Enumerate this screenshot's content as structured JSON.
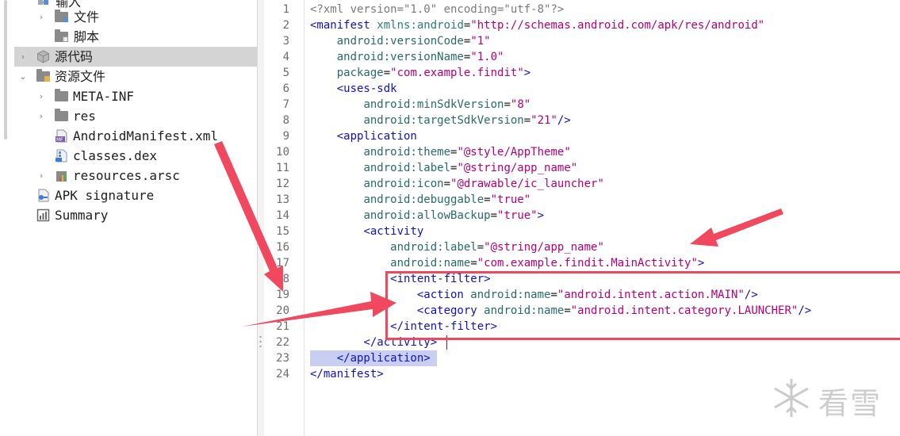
{
  "tree": {
    "items": [
      {
        "label": "输入",
        "chevron": "▸",
        "icon": "package-icon"
      },
      {
        "label": "文件",
        "chevron": "›",
        "icon": "folder-icon"
      },
      {
        "label": "脚本",
        "chevron": "",
        "icon": "folder-icon"
      },
      {
        "label": "源代码",
        "chevron": "›",
        "icon": "package-icon"
      },
      {
        "label": "资源文件",
        "chevron": "⌄",
        "icon": "folder-icon"
      },
      {
        "label": "META-INF",
        "chevron": "›",
        "icon": "folder-icon"
      },
      {
        "label": "res",
        "chevron": "›",
        "icon": "folder-icon"
      },
      {
        "label": "AndroidManifest.xml",
        "chevron": "",
        "icon": "manifest-file-icon"
      },
      {
        "label": "classes.dex",
        "chevron": "",
        "icon": "dex-file-icon"
      },
      {
        "label": "resources.arsc",
        "chevron": "›",
        "icon": "arsc-file-icon"
      },
      {
        "label": "APK signature",
        "chevron": "",
        "icon": "signature-icon"
      },
      {
        "label": "Summary",
        "chevron": "",
        "icon": "summary-icon"
      }
    ],
    "selected_index": 3
  },
  "editor": {
    "line_numbers": [
      "1",
      "2",
      "3",
      "4",
      "5",
      "6",
      "7",
      "8",
      "9",
      "10",
      "11",
      "12",
      "13",
      "14",
      "15",
      "16",
      "17",
      "18",
      "19",
      "20",
      "21",
      "22",
      "23",
      "24"
    ],
    "lines": [
      [
        [
          "decl",
          "<?xml version=\"1.0\" encoding=\"utf-8\"?>"
        ]
      ],
      [
        [
          "tag",
          "<manifest "
        ],
        [
          "ns",
          "xmlns:android"
        ],
        [
          "plain",
          "="
        ],
        [
          "val",
          "\"http://schemas.android.com/apk/res/android\""
        ]
      ],
      [
        [
          "plain",
          "    "
        ],
        [
          "attr",
          "android:versionCode"
        ],
        [
          "plain",
          "="
        ],
        [
          "val",
          "\"1\""
        ]
      ],
      [
        [
          "plain",
          "    "
        ],
        [
          "attr",
          "android:versionName"
        ],
        [
          "plain",
          "="
        ],
        [
          "val",
          "\"1.0\""
        ]
      ],
      [
        [
          "plain",
          "    "
        ],
        [
          "attr",
          "package"
        ],
        [
          "plain",
          "="
        ],
        [
          "val",
          "\"com.example.findit\""
        ],
        [
          "tag",
          ">"
        ]
      ],
      [
        [
          "plain",
          "    "
        ],
        [
          "tag",
          "<uses-sdk"
        ]
      ],
      [
        [
          "plain",
          "        "
        ],
        [
          "attr",
          "android:minSdkVersion"
        ],
        [
          "plain",
          "="
        ],
        [
          "val",
          "\"8\""
        ]
      ],
      [
        [
          "plain",
          "        "
        ],
        [
          "attr",
          "android:targetSdkVersion"
        ],
        [
          "plain",
          "="
        ],
        [
          "val",
          "\"21\""
        ],
        [
          "tag",
          "/>"
        ]
      ],
      [
        [
          "plain",
          "    "
        ],
        [
          "tag",
          "<application"
        ]
      ],
      [
        [
          "plain",
          "        "
        ],
        [
          "attr",
          "android:theme"
        ],
        [
          "plain",
          "="
        ],
        [
          "val",
          "\"@style/AppTheme\""
        ]
      ],
      [
        [
          "plain",
          "        "
        ],
        [
          "attr",
          "android:label"
        ],
        [
          "plain",
          "="
        ],
        [
          "val",
          "\"@string/app_name\""
        ]
      ],
      [
        [
          "plain",
          "        "
        ],
        [
          "attr",
          "android:icon"
        ],
        [
          "plain",
          "="
        ],
        [
          "val",
          "\"@drawable/ic_launcher\""
        ]
      ],
      [
        [
          "plain",
          "        "
        ],
        [
          "attr",
          "android:debuggable"
        ],
        [
          "plain",
          "="
        ],
        [
          "val",
          "\"true\""
        ]
      ],
      [
        [
          "plain",
          "        "
        ],
        [
          "attr",
          "android:allowBackup"
        ],
        [
          "plain",
          "="
        ],
        [
          "val",
          "\"true\""
        ],
        [
          "tag",
          ">"
        ]
      ],
      [
        [
          "plain",
          "        "
        ],
        [
          "tag",
          "<activity"
        ]
      ],
      [
        [
          "plain",
          "            "
        ],
        [
          "attr",
          "android:label"
        ],
        [
          "plain",
          "="
        ],
        [
          "val",
          "\"@string/app_name\""
        ]
      ],
      [
        [
          "plain",
          "            "
        ],
        [
          "attr",
          "android:name"
        ],
        [
          "plain",
          "="
        ],
        [
          "val",
          "\"com.example.findit.MainActivity\""
        ],
        [
          "tag",
          ">"
        ]
      ],
      [
        [
          "plain",
          "            "
        ],
        [
          "tag",
          "<intent-filter>"
        ]
      ],
      [
        [
          "plain",
          "                "
        ],
        [
          "tag",
          "<action "
        ],
        [
          "attr",
          "android:name"
        ],
        [
          "plain",
          "="
        ],
        [
          "val",
          "\"android.intent.action.MAIN\""
        ],
        [
          "tag",
          "/>"
        ]
      ],
      [
        [
          "plain",
          "                "
        ],
        [
          "tag",
          "<category "
        ],
        [
          "attr",
          "android:name"
        ],
        [
          "plain",
          "="
        ],
        [
          "val",
          "\"android.intent.category.LAUNCHER\""
        ],
        [
          "tag",
          "/>"
        ]
      ],
      [
        [
          "plain",
          "            "
        ],
        [
          "tag",
          "</intent-filter>"
        ]
      ],
      [
        [
          "plain",
          "        "
        ],
        [
          "tag",
          "</activity>"
        ]
      ],
      [
        [
          "plain",
          "    "
        ],
        [
          "tag",
          "</application>"
        ]
      ],
      [
        [
          "tag",
          "</manifest>"
        ]
      ]
    ]
  },
  "watermark": {
    "text": "看雪",
    "icon": "snowflake-icon"
  },
  "colors": {
    "annotation": "#f0485e",
    "selection": "#c9cff0"
  }
}
